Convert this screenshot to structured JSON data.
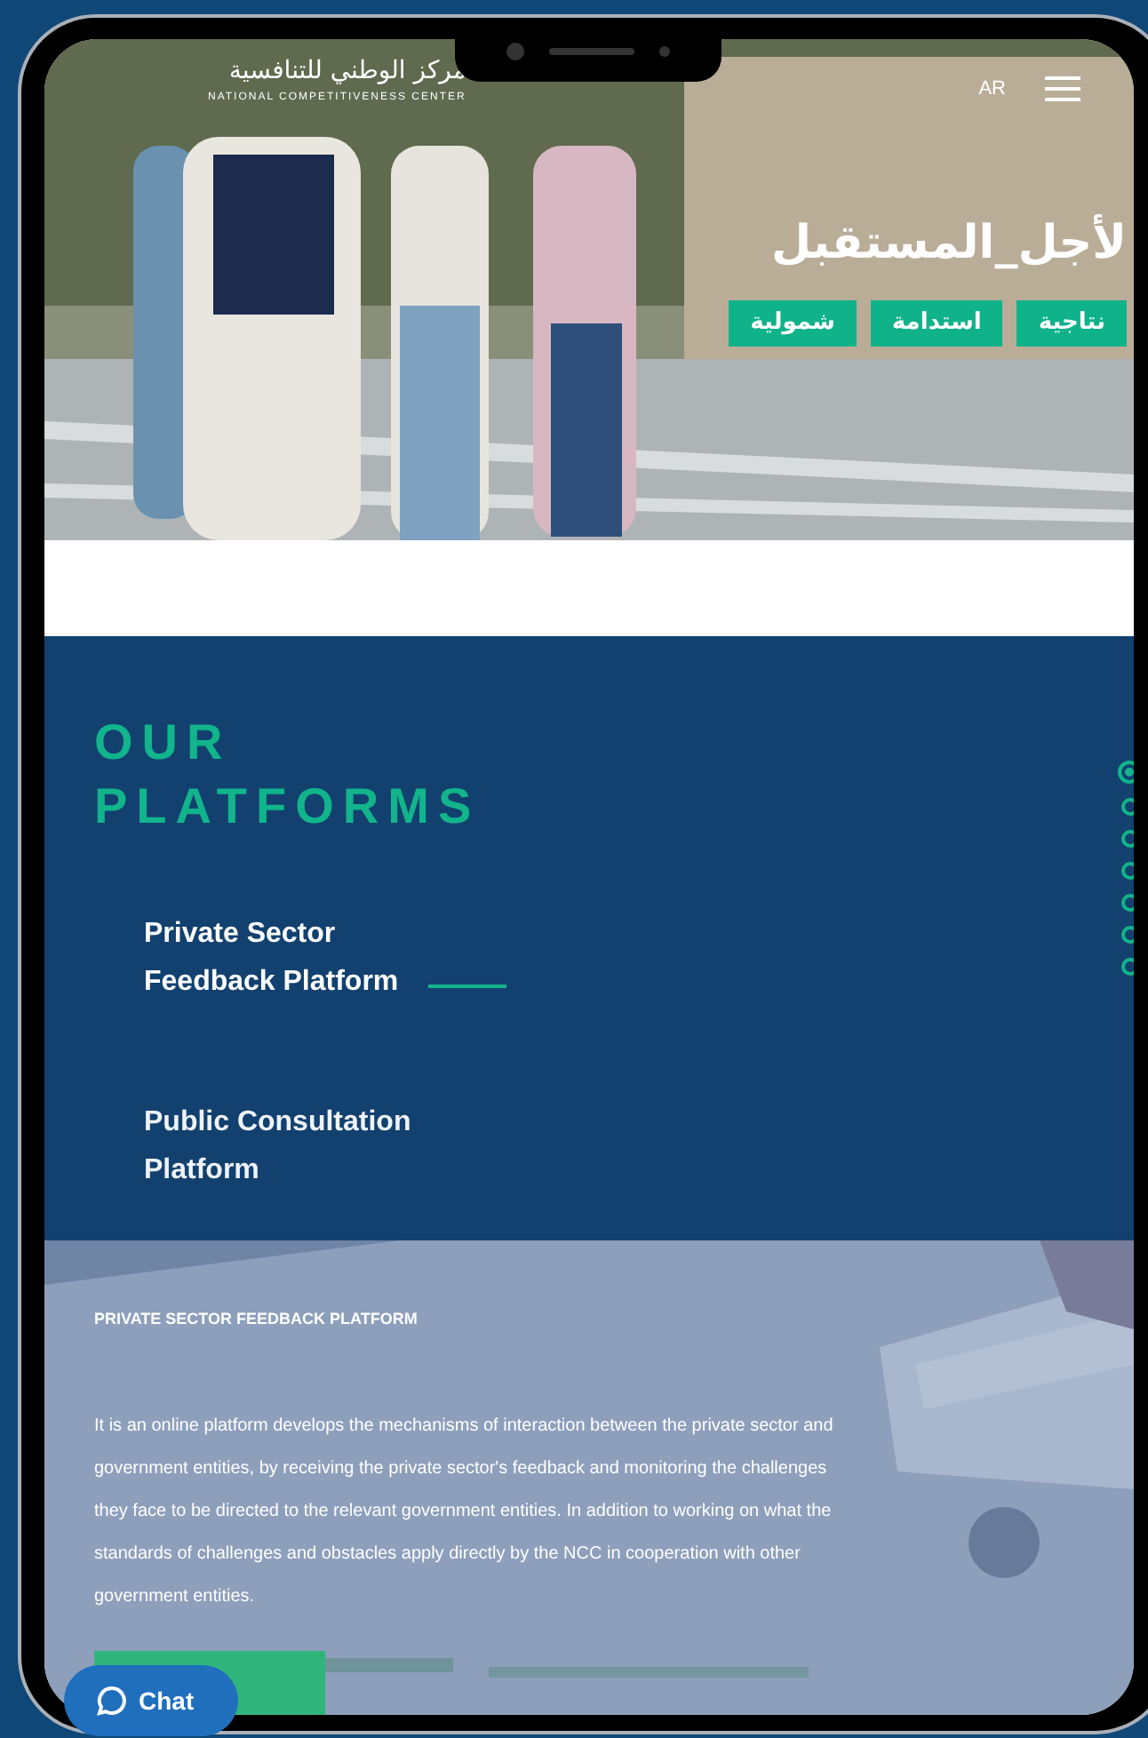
{
  "header": {
    "logo_arabic": "مركز الوطني للتنافسية",
    "logo_english": "NATIONAL COMPETITIVENESS CENTER",
    "language": "AR"
  },
  "hero": {
    "hashtag": "لأجل_المستقبل",
    "tags": [
      "نتاجية",
      "استدامة",
      "شمولية"
    ]
  },
  "platforms": {
    "title": "OUR PLATFORMS",
    "items": [
      {
        "label": "Private Sector Feedback Platform",
        "selected": true
      },
      {
        "label": "Public Consultation Platform",
        "selected": false
      }
    ],
    "pager": [
      {
        "selected": true
      },
      {
        "selected": false
      },
      {
        "selected": false
      },
      {
        "selected": false
      },
      {
        "selected": false
      },
      {
        "selected": false
      },
      {
        "selected": false
      }
    ]
  },
  "detail": {
    "title": "PRIVATE SECTOR FEEDBACK PLATFORM",
    "text": "It is an online platform develops the mechanisms of interaction between the private sector and government entities, by receiving the private sector's feedback and monitoring the challenges they face to be directed to the relevant government entities. In addition to working on what the standards of challenges and obstacles apply directly by the NCC in cooperation with other government entities."
  },
  "chat": {
    "label": "Chat"
  }
}
